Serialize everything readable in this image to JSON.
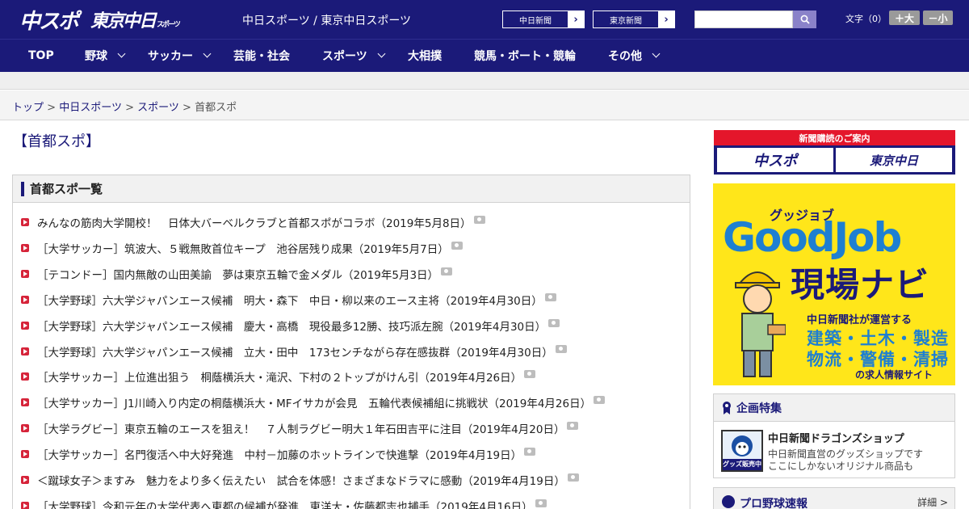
{
  "header": {
    "logo_chuspo": "中スポ",
    "logo_tokyo": "東京中日",
    "logo_tokyo_small": "スポーツ",
    "site_tagline": "中日スポーツ / 東京中日スポーツ",
    "paper_links": [
      {
        "label": "中日新聞"
      },
      {
        "label": "東京新聞"
      }
    ],
    "search": {
      "value": "",
      "icon": "search-icon"
    },
    "font_size_label": "文字（0）",
    "font_bigger": "＋大",
    "font_smaller": "－小"
  },
  "nav": {
    "items": [
      {
        "label": "TOP"
      },
      {
        "label": "野球"
      },
      {
        "label": "サッカー"
      },
      {
        "label": "芸能・社会"
      },
      {
        "label": "スポーツ"
      },
      {
        "label": "大相撲"
      },
      {
        "label": "競馬・ボート・競輪"
      },
      {
        "label": "その他"
      }
    ]
  },
  "breadcrumb": {
    "items": [
      "トップ",
      "中日スポーツ",
      "スポーツ"
    ],
    "separator": ">",
    "current": "首都スポ"
  },
  "page_title": "【首都スポ】",
  "list": {
    "heading": "首都スポ一覧",
    "articles": [
      "みんなの筋肉大学開校！　日体大バーベルクラブと首都スポがコラボ（2019年5月8日）",
      "［大学サッカー］筑波大、５戦無敗首位キープ　池谷居残り成果（2019年5月7日）",
      "［テコンドー］国内無敵の山田美諭　夢は東京五輪で金メダル（2019年5月3日）",
      "［大学野球］六大学ジャパンエース候補　明大・森下　中日・柳以来のエース主将（2019年4月30日）",
      "［大学野球］六大学ジャパンエース候補　慶大・高橋　現役最多12勝、技巧派左腕（2019年4月30日）",
      "［大学野球］六大学ジャパンエース候補　立大・田中　173センチながら存在感抜群（2019年4月30日）",
      "［大学サッカー］上位進出狙う　桐蔭横浜大・滝沢、下村の２トップがけん引（2019年4月26日）",
      "［大学サッカー］J1川崎入り内定の桐蔭横浜大・MFイサカが会見　五輪代表候補組に挑戦状（2019年4月26日）",
      "［大学ラグビー］東京五輪のエースを狙え！　７人制ラグビー明大１年石田吉平に注目（2019年4月20日）",
      "［大学サッカー］名門復活へ中大好発進　中村－加藤のホットラインで快進撃（2019年4月19日）",
      "＜蹴球女子＞ますみ　魅力をより多く伝えたい　試合を体感！さまざまなドラマに感動（2019年4月19日）",
      "［大学野球］令和元年の大学代表へ東都の候補が発進　東洋大・佐藤都志也捕手（2019年4月16日）"
    ]
  },
  "sidebar": {
    "subscription": {
      "title": "新聞購読のご案内",
      "logo1": "中スポ",
      "logo2": "東京中日"
    },
    "ad": {
      "catch": "グッジョブ",
      "logo": "GoodJob",
      "nav": "現場ナビ",
      "operator": "中日新聞社が運営する",
      "jobs_line1": "建築・土木・製造",
      "jobs_line2": "物流・警備・清掃",
      "sub": "の求人情報サイト"
    },
    "special": {
      "heading": "企画特集",
      "item_title": "中日新聞ドラゴンズショップ",
      "item_desc1": "中日新聞直営のグッズショップです",
      "item_desc2": "ここにしかないオリジナル商品も",
      "thumb_label": "グッズ販売中"
    },
    "baseball": {
      "heading": "プロ野球速報",
      "more": "詳細 >"
    }
  },
  "colors": {
    "brand_navy": "#1b1a79",
    "accent_red": "#d6243a",
    "ad_yellow": "#ffe61a",
    "ad_blue": "#1e7fd1"
  }
}
